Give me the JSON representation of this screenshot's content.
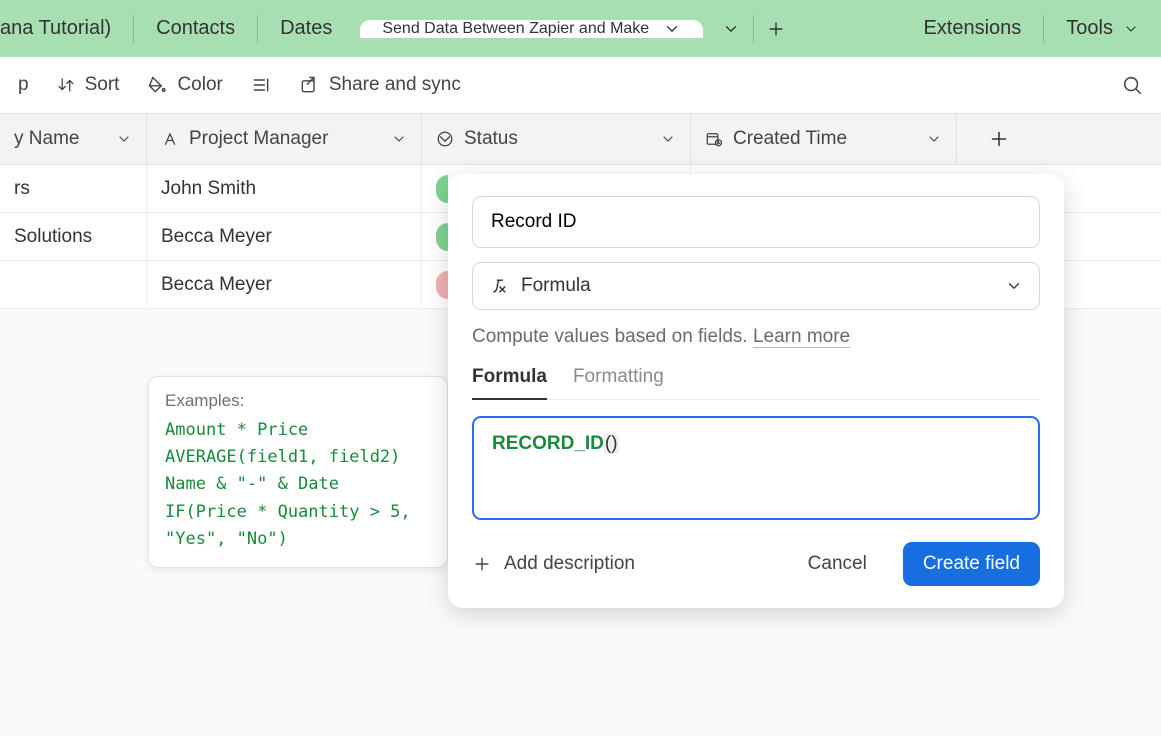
{
  "tabs": {
    "partial_left": "ana Tutorial)",
    "items": [
      "Contacts",
      "Dates"
    ],
    "active": "Send Data Between Zapier and Make",
    "right_group": [
      "Extensions",
      "Tools"
    ]
  },
  "toolbar": {
    "partial_left": "p",
    "sort": "Sort",
    "color": "Color",
    "share": "Share and sync"
  },
  "columns": {
    "name": "y Name",
    "pm": "Project Manager",
    "status": "Status",
    "created": "Created Time"
  },
  "rows": [
    {
      "name": "rs",
      "pm": "John Smith",
      "status_color": "green"
    },
    {
      "name": "Solutions",
      "pm": "Becca Meyer",
      "status_color": "green"
    },
    {
      "name": "",
      "pm": "Becca Meyer",
      "status_color": "red"
    }
  ],
  "examples": {
    "title": "Examples:",
    "lines": "Amount * Price\nAVERAGE(field1, field2)\nName & \"-\" & Date\nIF(Price * Quantity > 5, \"Yes\", \"No\")"
  },
  "popover": {
    "field_name": "Record ID",
    "type_label": "Formula",
    "helper": "Compute values based on fields.",
    "learn_more": "Learn more",
    "tabs": {
      "formula": "Formula",
      "formatting": "Formatting"
    },
    "formula_fn": "RECORD_ID",
    "formula_args": "()",
    "add_desc": "Add description",
    "cancel": "Cancel",
    "create": "Create field"
  }
}
